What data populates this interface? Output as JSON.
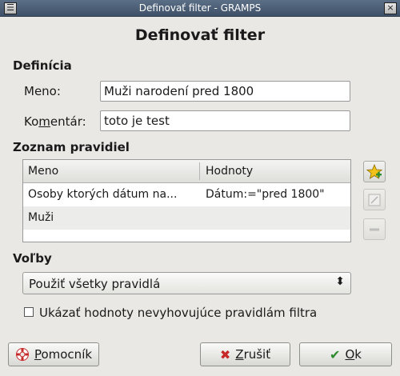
{
  "window": {
    "title": "Definovať filter - GRAMPS",
    "menu_glyph": "☰",
    "close_glyph": "×"
  },
  "dialog": {
    "heading": "Definovať filter"
  },
  "definition": {
    "section_label": "Definícia",
    "name_label": "Meno:",
    "name_value": "Muži narodení pred 1800",
    "comment_label_pre": "Ko",
    "comment_label_mnemonic": "m",
    "comment_label_post": "entár:",
    "comment_value": "toto je test"
  },
  "rules": {
    "section_label": "Zoznam pravidiel",
    "columns": [
      "Meno",
      "Hodnoty"
    ],
    "rows": [
      {
        "name": "Osoby ktorých dátum na...",
        "value": "Dátum:=\"pred 1800\""
      },
      {
        "name": "Muži",
        "value": ""
      }
    ],
    "add_icon": "add-star-icon",
    "edit_icon": "edit-icon",
    "remove_icon": "remove-icon"
  },
  "options": {
    "section_label": "Voľby",
    "combo_value": "Použiť všetky pravidlá",
    "combo_arrow": "⬍",
    "checkbox_label": "Ukázať hodnoty nevyhovujúce pravidlám filtra",
    "checkbox_checked": false
  },
  "buttons": {
    "help_mnemonic": "P",
    "help_rest": "omocník",
    "cancel_mnemonic": "Z",
    "cancel_rest": "rušiť",
    "ok_mnemonic": "O",
    "ok_rest": "k",
    "cancel_glyph": "✖",
    "ok_glyph": "✔"
  },
  "colors": {
    "titlebar": "#4b5d75",
    "cancel_icon": "#c62828",
    "ok_icon": "#2e8b2e",
    "add_star": "#f2c21b"
  }
}
